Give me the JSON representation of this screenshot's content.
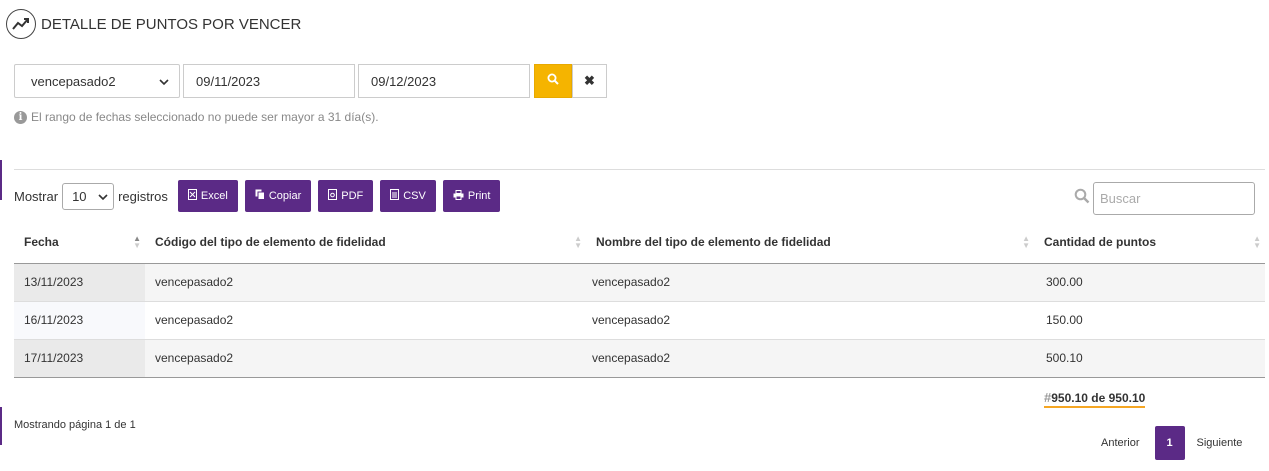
{
  "header": {
    "title": "DETALLE DE PUNTOS POR VENCER",
    "icon": "trending-up-icon"
  },
  "filters": {
    "type_value": "vencepasado2",
    "date_from": "09/11/2023",
    "date_to": "09/12/2023",
    "search_icon": "search-icon",
    "clear_icon": "close-icon",
    "clear_label": "✖"
  },
  "notice": "El rango de fechas seleccionado no puede ser mayor a 31 día(s).",
  "toolbar": {
    "show_label": "Mostrar",
    "page_length": "10",
    "records_label": "registros",
    "buttons": [
      {
        "label": "Excel",
        "icon": "excel-icon"
      },
      {
        "label": "Copiar",
        "icon": "copy-icon"
      },
      {
        "label": "PDF",
        "icon": "pdf-icon"
      },
      {
        "label": "CSV",
        "icon": "csv-icon"
      },
      {
        "label": "Print",
        "icon": "print-icon"
      }
    ],
    "search_placeholder": "Buscar"
  },
  "table": {
    "columns": [
      "Fecha",
      "Código del tipo de elemento de fidelidad",
      "Nombre del tipo de elemento de fidelidad",
      "Cantidad de puntos"
    ],
    "rows": [
      [
        "13/11/2023",
        "vencepasado2",
        "vencepasado2",
        "300.00"
      ],
      [
        "16/11/2023",
        "vencepasado2",
        "vencepasado2",
        "150.00"
      ],
      [
        "17/11/2023",
        "vencepasado2",
        "vencepasado2",
        "500.10"
      ]
    ]
  },
  "total": {
    "hash": "#",
    "text": "950.10 de 950.10"
  },
  "pagination": {
    "info": "Mostrando página 1 de 1",
    "prev": "Anterior",
    "current": "1",
    "next": "Siguiente"
  },
  "colors": {
    "accent": "#5b2a86",
    "search_button": "#f5b400",
    "total_underline": "#f5a623"
  }
}
